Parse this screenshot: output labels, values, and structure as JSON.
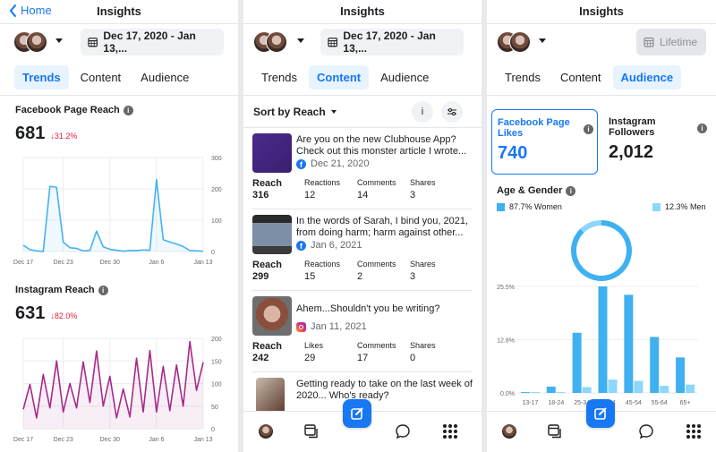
{
  "colors": {
    "accent": "#1877f2",
    "fb_series": "#45b2f0",
    "ig_series": "#a62b8a",
    "women": "#3fb1f0",
    "men": "#8dd6fc",
    "negative": "#e41e3f"
  },
  "header": {
    "back_label": "Home",
    "title": "Insights"
  },
  "tabs": [
    "Trends",
    "Content",
    "Audience"
  ],
  "trends": {
    "date_range": "Dec 17, 2020 - Jan 13,...",
    "active_tab": "Trends",
    "facebook": {
      "title": "Facebook Page Reach",
      "value": "681",
      "delta": "↓31.2%"
    },
    "instagram": {
      "title": "Instagram Reach",
      "value": "631",
      "delta": "↓82.0%"
    }
  },
  "content": {
    "date_range": "Dec 17, 2020 - Jan 13,...",
    "active_tab": "Content",
    "sort_label": "Sort by Reach",
    "info_label": "i",
    "posts": [
      {
        "text": "Are you on the new Clubhouse App? Check out this monster article I wrote...",
        "platform": "facebook",
        "date": "Dec 21, 2020",
        "stats": [
          {
            "label": "Reach",
            "value": "316"
          },
          {
            "label": "Reactions",
            "value": "12"
          },
          {
            "label": "Comments",
            "value": "14"
          },
          {
            "label": "Shares",
            "value": "3"
          }
        ]
      },
      {
        "text": "In the words of Sarah, I bind you, 2021, from doing harm; harm against other...",
        "platform": "facebook",
        "date": "Jan 6, 2021",
        "stats": [
          {
            "label": "Reach",
            "value": "299"
          },
          {
            "label": "Reactions",
            "value": "15"
          },
          {
            "label": "Comments",
            "value": "2"
          },
          {
            "label": "Shares",
            "value": "3"
          }
        ]
      },
      {
        "text": "Ahem...Shouldn't you be writing?",
        "platform": "instagram",
        "date": "Jan 11, 2021",
        "stats": [
          {
            "label": "Reach",
            "value": "242"
          },
          {
            "label": "Likes",
            "value": "29"
          },
          {
            "label": "Comments",
            "value": "17"
          },
          {
            "label": "Shares",
            "value": "0"
          }
        ]
      },
      {
        "text": "Getting ready to take on the last week of 2020... Who's ready?",
        "platform": "instagram"
      }
    ]
  },
  "audience": {
    "date_range": "Lifetime",
    "active_tab": "Audience",
    "fb_likes": {
      "label": "Facebook Page Likes",
      "value": "740"
    },
    "ig_followers": {
      "label": "Instagram Followers",
      "value": "2,012"
    },
    "age_gender_title": "Age & Gender",
    "women_legend": "87.7% Women",
    "men_legend": "12.3% Men"
  },
  "bottom_nav": [
    "profile",
    "pages",
    "compose",
    "messages",
    "menu"
  ],
  "chart_data": [
    {
      "type": "area",
      "title": "Facebook Page Reach",
      "x_ticks": [
        "Dec 17",
        "Dec 23",
        "Dec 30",
        "Jan 6",
        "Jan 13"
      ],
      "y_ticks": [
        0,
        100,
        200,
        300
      ],
      "ylim": [
        0,
        300
      ],
      "grid": true,
      "x": [
        "Dec 17",
        "Dec 18",
        "Dec 19",
        "Dec 20",
        "Dec 21",
        "Dec 22",
        "Dec 23",
        "Dec 24",
        "Dec 25",
        "Dec 26",
        "Dec 27",
        "Dec 28",
        "Dec 29",
        "Dec 30",
        "Dec 31",
        "Jan 1",
        "Jan 2",
        "Jan 3",
        "Jan 4",
        "Jan 5",
        "Jan 6",
        "Jan 7",
        "Jan 8",
        "Jan 9",
        "Jan 10",
        "Jan 11",
        "Jan 12",
        "Jan 13"
      ],
      "values": [
        20,
        6,
        2,
        0,
        208,
        205,
        30,
        12,
        10,
        2,
        3,
        65,
        15,
        7,
        4,
        1,
        3,
        3,
        5,
        4,
        230,
        38,
        30,
        24,
        16,
        3,
        2,
        1
      ]
    },
    {
      "type": "area",
      "title": "Instagram Reach",
      "x_ticks": [
        "Dec 17",
        "Dec 23",
        "Dec 30",
        "Jan 6",
        "Jan 13"
      ],
      "y_ticks": [
        0,
        50,
        100,
        150,
        200
      ],
      "ylim": [
        0,
        200
      ],
      "grid": true,
      "x": [
        "Dec 17",
        "Dec 18",
        "Dec 19",
        "Dec 20",
        "Dec 21",
        "Dec 22",
        "Dec 23",
        "Dec 24",
        "Dec 25",
        "Dec 26",
        "Dec 27",
        "Dec 28",
        "Dec 29",
        "Dec 30",
        "Dec 31",
        "Jan 1",
        "Jan 2",
        "Jan 3",
        "Jan 4",
        "Jan 5",
        "Jan 6",
        "Jan 7",
        "Jan 8",
        "Jan 9",
        "Jan 10",
        "Jan 11",
        "Jan 12",
        "Jan 13"
      ],
      "values": [
        43,
        98,
        24,
        120,
        46,
        150,
        37,
        100,
        46,
        148,
        58,
        172,
        50,
        116,
        24,
        88,
        26,
        156,
        37,
        173,
        37,
        138,
        40,
        141,
        50,
        193,
        85,
        147
      ]
    },
    {
      "type": "pie",
      "title": "Age & Gender",
      "labels": [
        "Women",
        "Men"
      ],
      "values": [
        87.7,
        12.3
      ]
    },
    {
      "type": "bar",
      "title": "Age & Gender",
      "categories": [
        "13-17",
        "18-24",
        "25-34",
        "35-44",
        "45-54",
        "55-64",
        "65+"
      ],
      "y_ticks": [
        "0.0%",
        "12.8%",
        "25.5%"
      ],
      "ylim": [
        0,
        25.5
      ],
      "series": [
        {
          "name": "Women",
          "values": [
            0.2,
            1.5,
            14.4,
            25.5,
            23.5,
            13.4,
            8.5
          ]
        },
        {
          "name": "Men",
          "values": [
            0.2,
            0.2,
            1.4,
            3.2,
            2.9,
            1.7,
            2.0
          ]
        }
      ]
    }
  ]
}
